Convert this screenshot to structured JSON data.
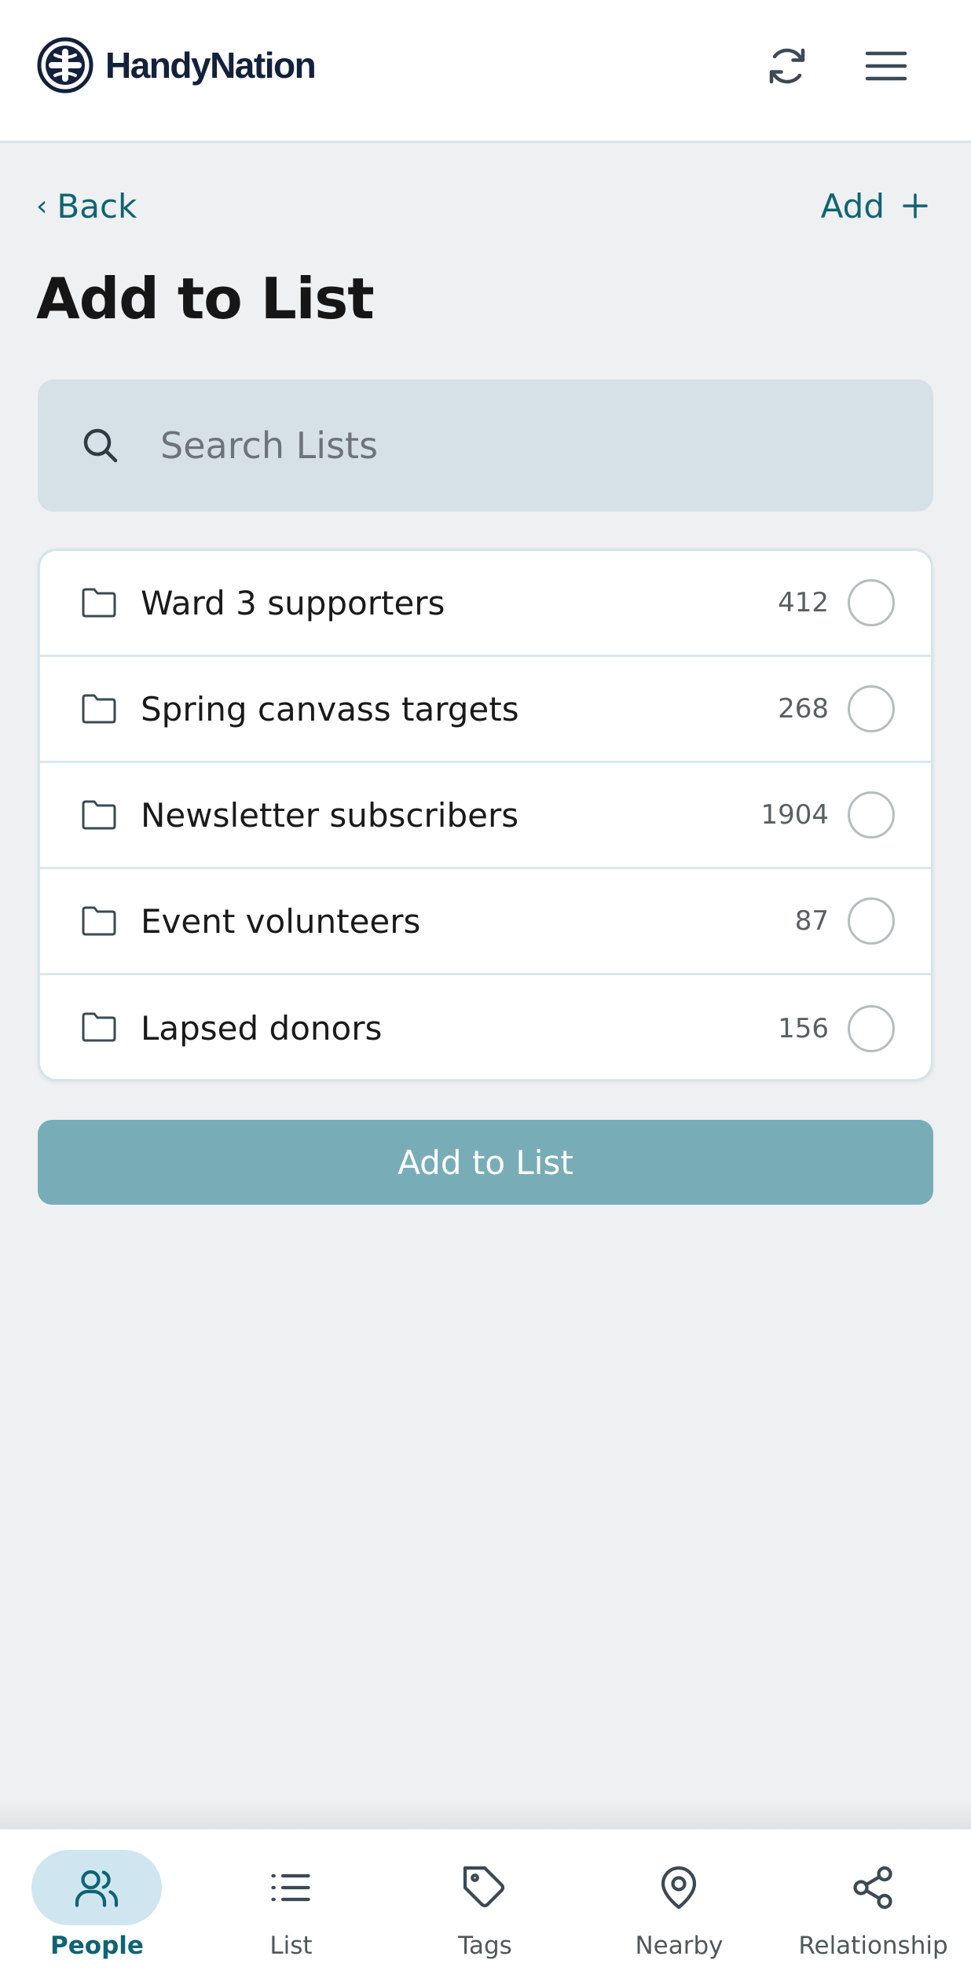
{
  "app": {
    "name": "HandyNation"
  },
  "colors": {
    "accent": "#0e6473",
    "brand_navy": "#13213c",
    "button_disabled": "#78adb8",
    "search_bg": "#d6e1e7",
    "page_bg": "#eff0f2"
  },
  "header": {
    "logo_icon": "handynation-logo-icon",
    "refresh_icon": "refresh-icon",
    "menu_icon": "hamburger-menu-icon"
  },
  "nav": {
    "back_label": "Back",
    "back_chevron": "‹",
    "add_label": "Add"
  },
  "page": {
    "title": "Add to List"
  },
  "search": {
    "placeholder": "Search Lists",
    "value": ""
  },
  "lists": [
    {
      "name": "Ward 3 supporters",
      "count": "412",
      "selected": false
    },
    {
      "name": "Spring canvass targets",
      "count": "268",
      "selected": false
    },
    {
      "name": "Newsletter subscribers",
      "count": "1904",
      "selected": false
    },
    {
      "name": "Event volunteers",
      "count": "87",
      "selected": false
    },
    {
      "name": "Lapsed donors",
      "count": "156",
      "selected": false
    }
  ],
  "primary_button": {
    "label": "Add to List",
    "enabled": false
  },
  "bottom_nav": [
    {
      "label": "People",
      "icon": "people-icon",
      "active": true
    },
    {
      "label": "List",
      "icon": "list-icon",
      "active": false
    },
    {
      "label": "Tags",
      "icon": "tag-icon",
      "active": false
    },
    {
      "label": "Nearby",
      "icon": "map-pin-icon",
      "active": false
    },
    {
      "label": "Relationship",
      "icon": "share-icon",
      "active": false
    }
  ]
}
